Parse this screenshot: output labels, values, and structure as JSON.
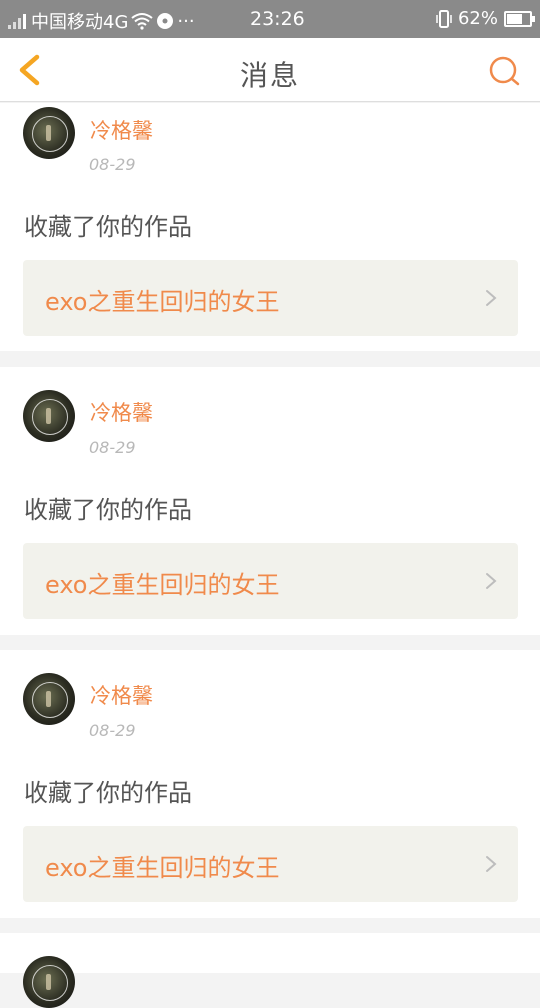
{
  "status_bar": {
    "carrier": "中国移动4G",
    "time": "23:26",
    "battery": "62%",
    "battery_level": 0.62
  },
  "nav": {
    "title": "消息",
    "back_icon": "chevron-left-icon",
    "search_icon": "search-icon"
  },
  "colors": {
    "accent": "#f08a4b",
    "back_arrow": "#f5a623",
    "box_bg": "#f2f2ec"
  },
  "messages": [
    {
      "username": "冷格馨",
      "date": "08-29",
      "action": "收藏了你的作品",
      "work_title": "exo之重生回归的女王"
    },
    {
      "username": "冷格馨",
      "date": "08-29",
      "action": "收藏了你的作品",
      "work_title": "exo之重生回归的女王"
    },
    {
      "username": "冷格馨",
      "date": "08-29",
      "action": "收藏了你的作品",
      "work_title": "exo之重生回归的女王"
    }
  ]
}
